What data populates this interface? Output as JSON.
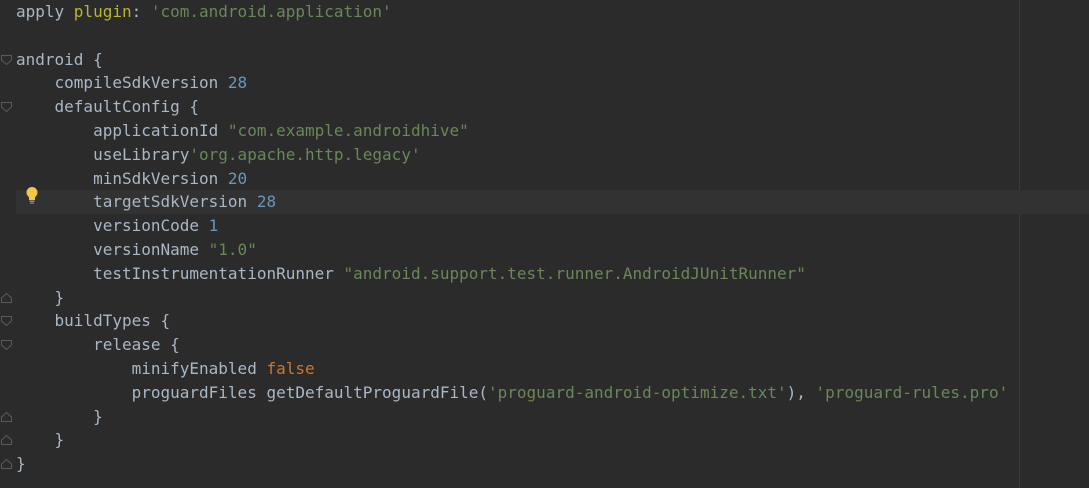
{
  "editor": {
    "lines": [
      {
        "tokens": [
          {
            "t": "apply ",
            "c": "id"
          },
          {
            "t": "plugin",
            "c": "plugin-attr"
          },
          {
            "t": ": ",
            "c": "id"
          },
          {
            "t": "'com.android.application'",
            "c": "str"
          }
        ]
      },
      {
        "tokens": []
      },
      {
        "tokens": [
          {
            "t": "android {",
            "c": "id"
          }
        ]
      },
      {
        "tokens": [
          {
            "t": "    compileSdkVersion ",
            "c": "id"
          },
          {
            "t": "28",
            "c": "num"
          }
        ]
      },
      {
        "tokens": [
          {
            "t": "    defaultConfig {",
            "c": "id"
          }
        ]
      },
      {
        "tokens": [
          {
            "t": "        applicationId ",
            "c": "id"
          },
          {
            "t": "\"com.example.androidhive\"",
            "c": "str"
          }
        ]
      },
      {
        "tokens": [
          {
            "t": "        useLibrary",
            "c": "id"
          },
          {
            "t": "'org.apache.http.legacy'",
            "c": "str"
          }
        ]
      },
      {
        "tokens": [
          {
            "t": "        minSdkVersion ",
            "c": "id"
          },
          {
            "t": "20",
            "c": "num"
          }
        ]
      },
      {
        "tokens": [
          {
            "t": "        targetSdkVersion ",
            "c": "id"
          },
          {
            "t": "28",
            "c": "num"
          }
        ],
        "current": true
      },
      {
        "tokens": [
          {
            "t": "        versionCode ",
            "c": "id"
          },
          {
            "t": "1",
            "c": "num"
          }
        ]
      },
      {
        "tokens": [
          {
            "t": "        versionName ",
            "c": "id"
          },
          {
            "t": "\"1.0\"",
            "c": "str"
          }
        ]
      },
      {
        "tokens": [
          {
            "t": "        testInstrumentationRunner ",
            "c": "id"
          },
          {
            "t": "\"android.support.test.runner.AndroidJUnitRunner\"",
            "c": "str"
          }
        ]
      },
      {
        "tokens": [
          {
            "t": "    }",
            "c": "id"
          }
        ]
      },
      {
        "tokens": [
          {
            "t": "    buildTypes {",
            "c": "id"
          }
        ]
      },
      {
        "tokens": [
          {
            "t": "        release {",
            "c": "id"
          }
        ]
      },
      {
        "tokens": [
          {
            "t": "            minifyEnabled ",
            "c": "id"
          },
          {
            "t": "false",
            "c": "kw"
          }
        ]
      },
      {
        "tokens": [
          {
            "t": "            proguardFiles getDefaultProguardFile(",
            "c": "id"
          },
          {
            "t": "'proguard-android-optimize.txt'",
            "c": "str"
          },
          {
            "t": "), ",
            "c": "id"
          },
          {
            "t": "'proguard-rules.pro'",
            "c": "str"
          }
        ]
      },
      {
        "tokens": [
          {
            "t": "        }",
            "c": "id"
          }
        ]
      },
      {
        "tokens": [
          {
            "t": "    }",
            "c": "id"
          }
        ]
      },
      {
        "tokens": [
          {
            "t": "}",
            "c": "id"
          }
        ]
      }
    ],
    "fold_markers": [
      {
        "line": 2,
        "kind": "open"
      },
      {
        "line": 4,
        "kind": "open"
      },
      {
        "line": 12,
        "kind": "close"
      },
      {
        "line": 13,
        "kind": "open"
      },
      {
        "line": 14,
        "kind": "open"
      },
      {
        "line": 17,
        "kind": "close"
      },
      {
        "line": 18,
        "kind": "close"
      },
      {
        "line": 19,
        "kind": "close"
      }
    ],
    "intention_icon": "lightbulb-icon",
    "colors": {
      "background": "#2b2b2b",
      "current_line": "#323232",
      "default_text": "#a9b7c6",
      "string": "#6a8759",
      "number": "#6897bb",
      "keyword": "#cc7832",
      "plugin_attr": "#bbb529"
    }
  }
}
